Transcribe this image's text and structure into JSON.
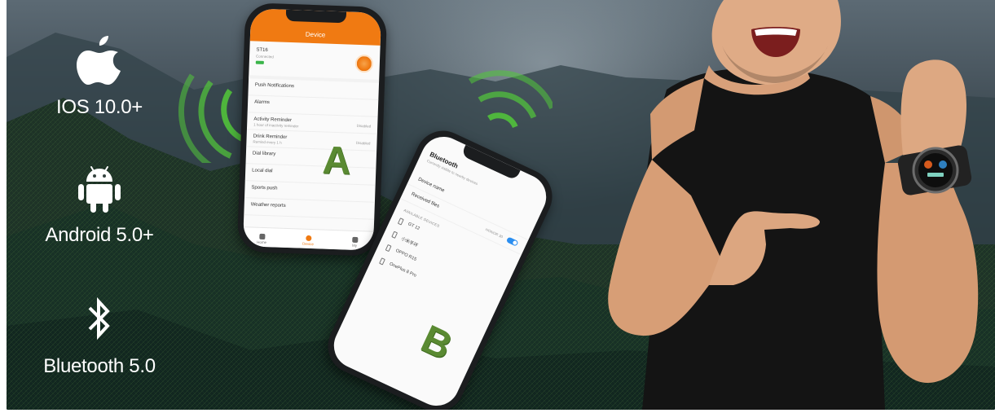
{
  "compatibility": [
    {
      "icon": "apple-icon",
      "label": "IOS 10.0+"
    },
    {
      "icon": "android-icon",
      "label": "Android 5.0+"
    },
    {
      "icon": "bluetooth-icon",
      "label": "Bluetooth 5.0"
    }
  ],
  "phone_a": {
    "header": "Device",
    "device_name": "ST16",
    "device_status": "Connected",
    "rows": [
      {
        "label": "Push Notifications",
        "sub": "",
        "value": ""
      },
      {
        "label": "Alarms",
        "sub": "",
        "value": ""
      },
      {
        "label": "Activity Reminder",
        "sub": "1 hour of inactivity reminder",
        "value": "Disabled"
      },
      {
        "label": "Drink Reminder",
        "sub": "Remind every 1 h",
        "value": "Disabled"
      },
      {
        "label": "Dial library",
        "sub": "",
        "value": ""
      },
      {
        "label": "Local dial",
        "sub": "",
        "value": ""
      },
      {
        "label": "Sports push",
        "sub": "",
        "value": ""
      },
      {
        "label": "Weather reports",
        "sub": "",
        "value": ""
      }
    ],
    "tabs": [
      "Home",
      "Device",
      "My"
    ],
    "letter": "A"
  },
  "phone_b": {
    "title": "Bluetooth",
    "subtitle": "Currently visible to nearby devices",
    "device_name_label": "Device name",
    "received_files_label": "Received files",
    "received_files_value": "HONOR 30",
    "section": "AVAILABLE DEVICES",
    "devices": [
      "GT 12",
      "小米手环",
      "OPPO R15",
      "OnePlus 8 Pro"
    ],
    "letter": "B"
  },
  "colors": {
    "accent_orange": "#f07a12",
    "signal_green": "#52c93a",
    "letter_green": "#5a8a32"
  }
}
